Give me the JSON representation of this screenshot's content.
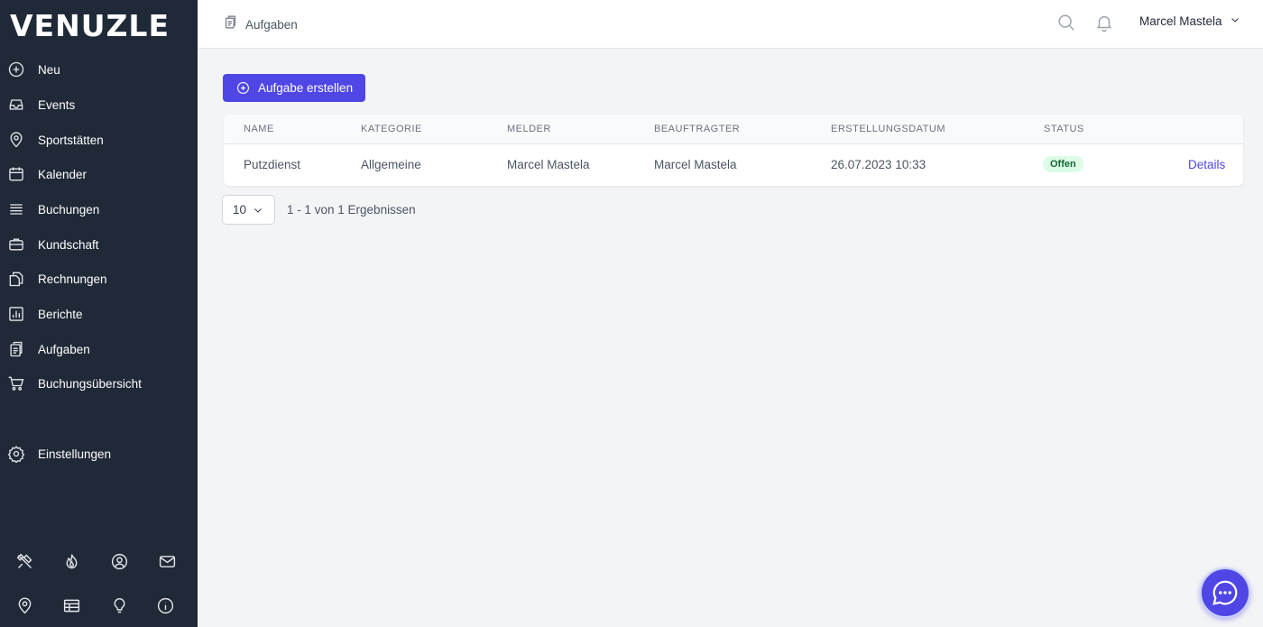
{
  "brand": {
    "logo_text": "VENUZLE"
  },
  "sidebar": {
    "items": [
      {
        "label": "Neu",
        "icon": "plus-circle-icon"
      },
      {
        "label": "Events",
        "icon": "inbox-icon"
      },
      {
        "label": "Sportstätten",
        "icon": "map-pin-icon"
      },
      {
        "label": "Kalender",
        "icon": "calendar-icon"
      },
      {
        "label": "Buchungen",
        "icon": "list-icon"
      },
      {
        "label": "Kundschaft",
        "icon": "briefcase-icon"
      },
      {
        "label": "Rechnungen",
        "icon": "documents-icon"
      },
      {
        "label": "Berichte",
        "icon": "bar-chart-icon"
      },
      {
        "label": "Aufgaben",
        "icon": "clipboard-icon"
      },
      {
        "label": "Buchungsübersicht",
        "icon": "cart-icon"
      }
    ],
    "settings": {
      "label": "Einstellungen",
      "icon": "gear-icon"
    },
    "bottom_icons": [
      "tools-icon",
      "fire-icon",
      "user-circle-icon",
      "mail-icon",
      "location-icon",
      "table-icon",
      "lightbulb-icon",
      "info-icon"
    ]
  },
  "header": {
    "breadcrumb": "Aufgaben",
    "user_name": "Marcel Mastela"
  },
  "main": {
    "create_button": "Aufgabe erstellen",
    "table": {
      "columns": [
        "NAME",
        "KATEGORIE",
        "MELDER",
        "BEAUFTRAGTER",
        "ERSTELLUNGSDATUM",
        "STATUS"
      ],
      "rows": [
        {
          "name": "Putzdienst",
          "kategorie": "Allgemeine",
          "melder": "Marcel Mastela",
          "beauftragter": "Marcel Mastela",
          "erstellungsdatum": "26.07.2023 10:33",
          "status": "Offen",
          "action": "Details"
        }
      ]
    },
    "pagination": {
      "page_size": "10",
      "info": "1 - 1 von 1 Ergebnissen"
    }
  },
  "colors": {
    "sidebar_bg": "#1f2937",
    "accent": "#4f46e5",
    "status_open_bg": "#dcfce7",
    "status_open_text": "#166534"
  }
}
